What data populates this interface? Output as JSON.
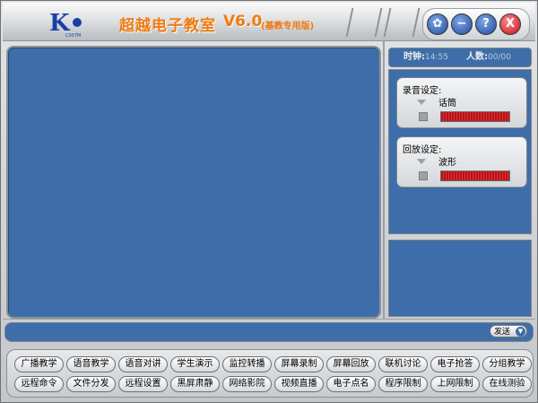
{
  "app": {
    "logo_sub": "C007M",
    "title": "超越电子教室",
    "version": "V6.0",
    "edition": "(基教专用版)"
  },
  "window_buttons": [
    {
      "name": "settings-button",
      "icon": "gear-icon",
      "glyph": "✿"
    },
    {
      "name": "minimize-button",
      "icon": "minus-icon",
      "glyph": "−"
    },
    {
      "name": "help-button",
      "icon": "question-icon",
      "glyph": "?"
    },
    {
      "name": "close-button",
      "icon": "close-icon",
      "glyph": "X"
    }
  ],
  "status": {
    "clock_label": "时钟:",
    "clock_value": "14:55",
    "people_label": "人数:",
    "people_value": "00/00"
  },
  "record": {
    "title": "录音设定:",
    "value": "话筒"
  },
  "playback": {
    "title": "回放设定:",
    "value": "波形"
  },
  "send": {
    "label": "发送",
    "dropdown_icon": "chevron-down-icon"
  },
  "buttons_row1": [
    "广播教学",
    "语音教学",
    "语音对讲",
    "学生演示",
    "监控转播",
    "屏幕录制",
    "屏幕回放",
    "联机讨论",
    "电子抢答",
    "分组教学"
  ],
  "buttons_row2": [
    "远程命令",
    "文件分发",
    "远程设置",
    "黑屏肃静",
    "网络影院",
    "视频直播",
    "电子点名",
    "程序限制",
    "上网限制",
    "在线测验"
  ],
  "colors": {
    "panel_blue": "#3e6ea9",
    "title_orange": "#ef7a12",
    "meter_red": "#d0222a"
  }
}
